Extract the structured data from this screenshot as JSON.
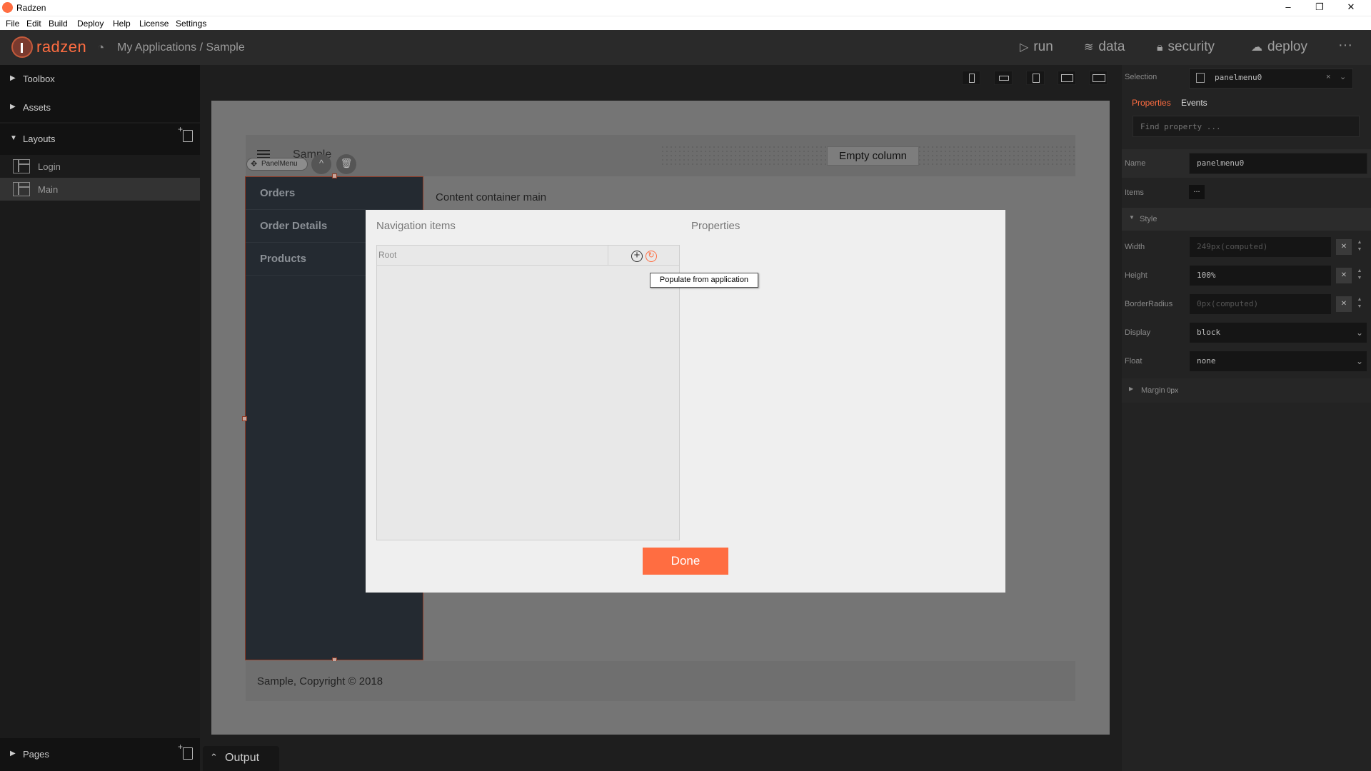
{
  "window": {
    "title": "Radzen",
    "minimize": "–",
    "restore": "❐",
    "close": "✕"
  },
  "menubar": [
    "File",
    "Edit",
    "Build",
    "Deploy",
    "Help",
    "License",
    "Settings"
  ],
  "appbar": {
    "logo": "radzen",
    "breadcrumb": "My Applications / Sample",
    "actions": {
      "run": "run",
      "data": "data",
      "security": "security",
      "deploy": "deploy"
    },
    "more": "···"
  },
  "sidebar": {
    "toolbox": "Toolbox",
    "assets": "Assets",
    "layouts": "Layouts",
    "layout_items": [
      "Login",
      "Main"
    ],
    "pages": "Pages"
  },
  "canvas": {
    "header_title": "Sample",
    "empty_column": "Empty column",
    "component_chip": "PanelMenu",
    "chip_up": "^",
    "chip_delete": "🗑",
    "menu_items": [
      "Orders",
      "Order Details",
      "Products"
    ],
    "content_title": "Content container main",
    "footer": "Sample, Copyright © 2018"
  },
  "dialog": {
    "nav_items_title": "Navigation items",
    "properties_title": "Properties",
    "root_label": "Root",
    "add_icon": "+",
    "populate_icon": "↻",
    "tooltip": "Populate from application",
    "done": "Done"
  },
  "properties_panel": {
    "selection_label": "Selection",
    "selection_value": "panelmenu0",
    "clear": "×",
    "chevron": "⌄",
    "tabs": {
      "properties": "Properties",
      "events": "Events"
    },
    "find_placeholder": "Find property ...",
    "name_label": "Name",
    "name_value": "panelmenu0",
    "items_label": "Items",
    "items_button": "...",
    "style_label": "Style",
    "width_label": "Width",
    "width_value": "249px(computed)",
    "height_label": "Height",
    "height_value": "100%",
    "radius_label": "BorderRadius",
    "radius_value": "0px(computed)",
    "display_label": "Display",
    "display_value": "block",
    "float_label": "Float",
    "float_value": "none",
    "margin_label": "Margin",
    "margin_value": "0px"
  },
  "output_tab": "Output",
  "colors": {
    "accent": "#ff6d41",
    "panel_dark": "#232323",
    "sidebar": "#1b1b1b"
  }
}
